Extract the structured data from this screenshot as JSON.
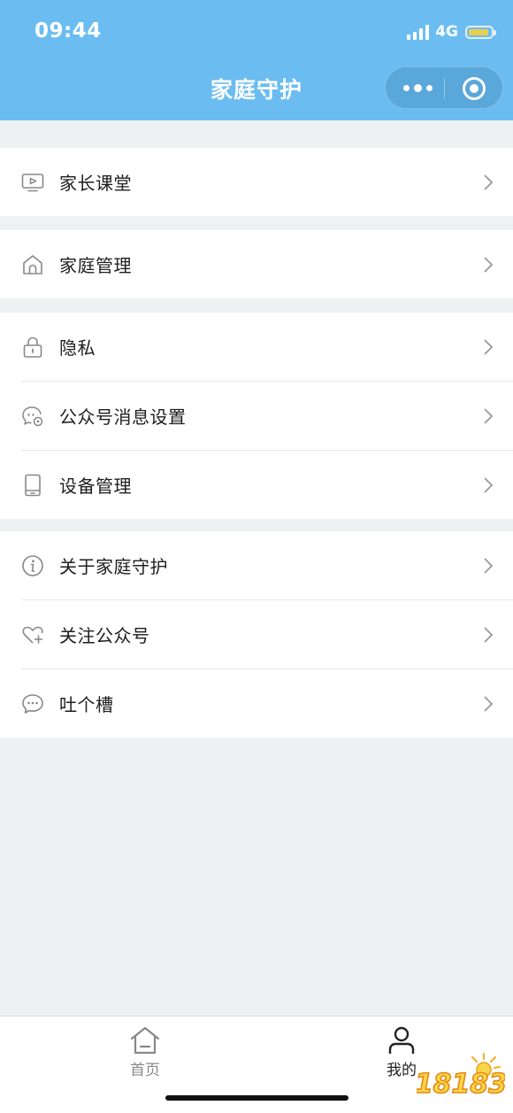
{
  "status_bar": {
    "time": "09:44",
    "network": "4G"
  },
  "header": {
    "title": "家庭守护"
  },
  "groups": [
    {
      "items": [
        {
          "icon": "tv-play-icon",
          "label": "家长课堂"
        }
      ]
    },
    {
      "items": [
        {
          "icon": "home-icon",
          "label": "家庭管理"
        }
      ]
    },
    {
      "items": [
        {
          "icon": "lock-icon",
          "label": "隐私"
        },
        {
          "icon": "chat-settings-icon",
          "label": "公众号消息设置"
        },
        {
          "icon": "phone-device-icon",
          "label": "设备管理"
        }
      ]
    },
    {
      "items": [
        {
          "icon": "info-icon",
          "label": "关于家庭守护"
        },
        {
          "icon": "heart-plus-icon",
          "label": "关注公众号"
        },
        {
          "icon": "chat-bubble-icon",
          "label": "吐个槽"
        }
      ]
    }
  ],
  "tabbar": {
    "tabs": [
      {
        "icon": "home-tab-icon",
        "label": "首页",
        "active": false
      },
      {
        "icon": "user-icon",
        "label": "我的",
        "active": true
      }
    ]
  },
  "watermark": {
    "text": "18183"
  },
  "colors": {
    "header_bg": "#6bbdf1",
    "page_bg": "#eef1f1",
    "battery": "#f5d33f"
  }
}
